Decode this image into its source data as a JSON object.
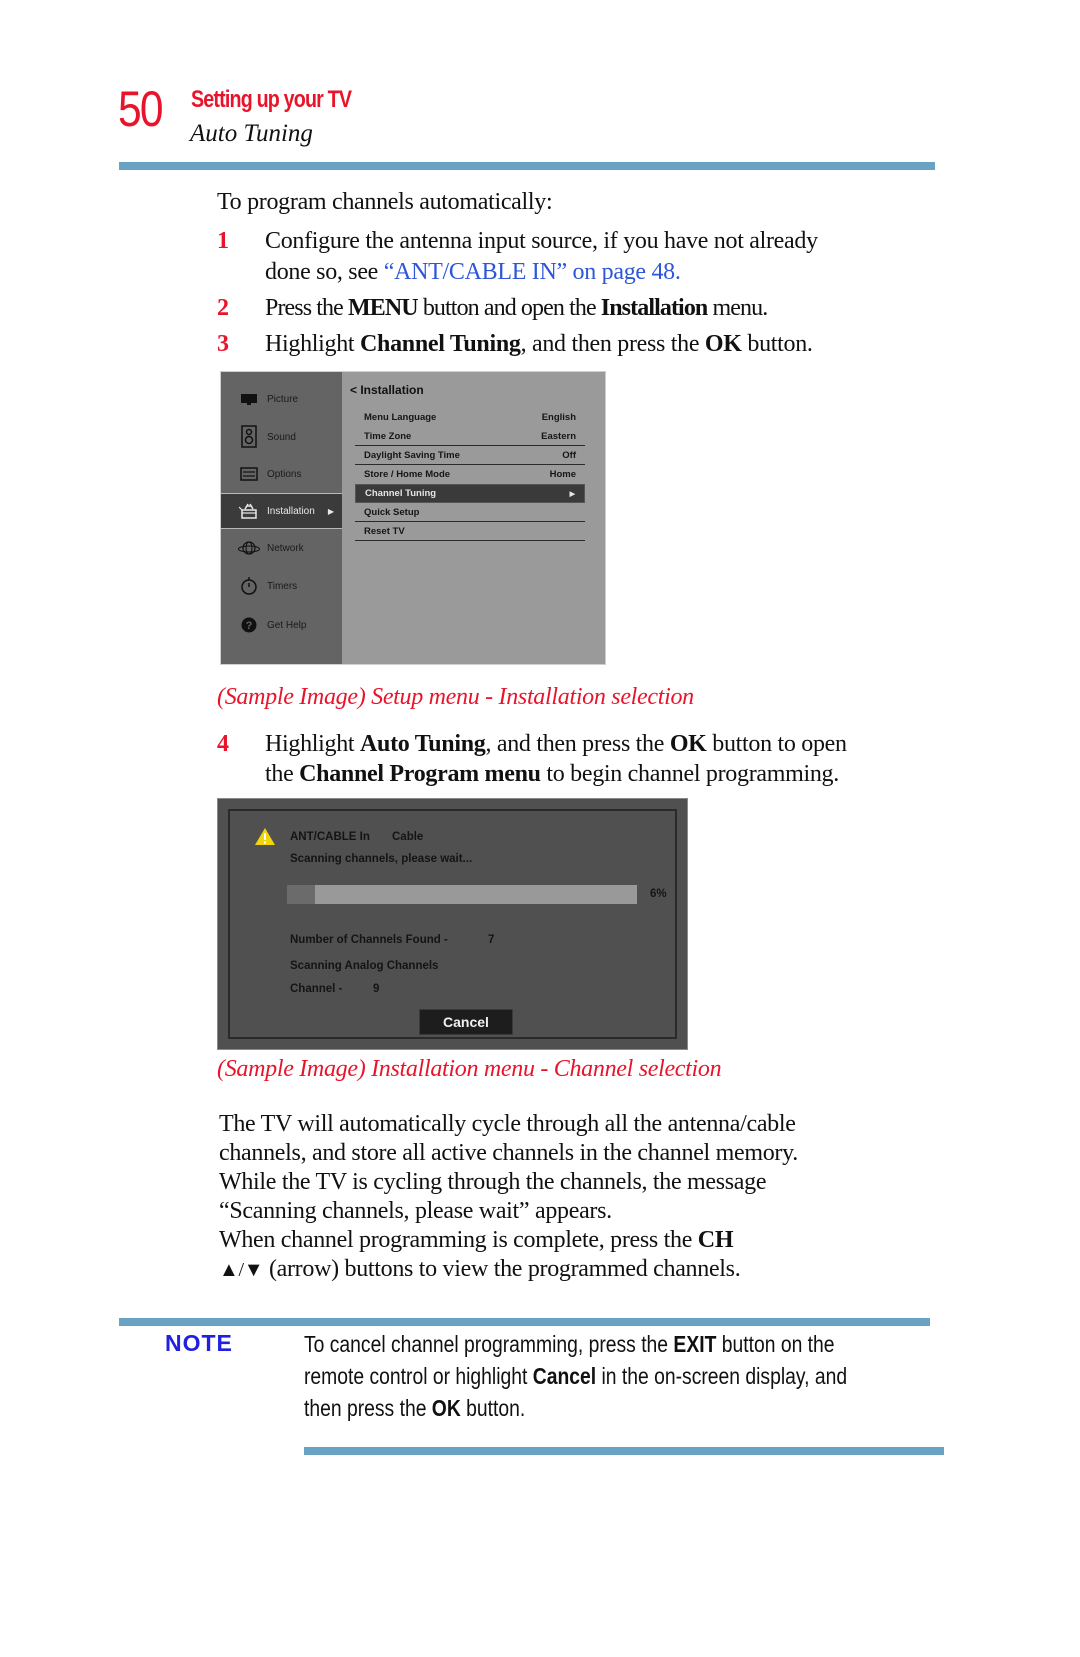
{
  "header": {
    "page_number": "50",
    "chapter": "Setting up your TV",
    "section": "Auto Tuning"
  },
  "intro": "To program channels automatically:",
  "steps": [
    {
      "num": "1",
      "line1": "Configure the antenna input source, if you have not already",
      "line2_pre": "done so, see ",
      "line2_link": "“ANT/CABLE IN” on page 48."
    },
    {
      "num": "2",
      "pre": "Press the ",
      "b1": "MENU",
      "mid": " button and open the ",
      "b2": "Installation",
      "post": " menu."
    },
    {
      "num": "3",
      "pre": "Highlight ",
      "b1": "Channel Tuning",
      "mid": ", and then press the ",
      "b2": "OK",
      "post": " button."
    },
    {
      "num": "4",
      "pre": "Highlight ",
      "b1": "Auto Tuning",
      "mid": ", and then press the ",
      "b2": "OK",
      "post": " button to open",
      "line2_pre": "the ",
      "line2_b": "Channel Program menu",
      "line2_post": " to begin channel programming."
    }
  ],
  "setup_menu": {
    "sidebar": [
      {
        "label": "Picture",
        "icon": "tv-icon"
      },
      {
        "label": "Sound",
        "icon": "speaker-icon"
      },
      {
        "label": "Options",
        "icon": "options-icon"
      },
      {
        "label": "Installation",
        "icon": "toolbox-icon",
        "active": true
      },
      {
        "label": "Network",
        "icon": "globe-icon"
      },
      {
        "label": "Timers",
        "icon": "stopwatch-icon"
      },
      {
        "label": "Get Help",
        "icon": "help-icon"
      }
    ],
    "title": "< Installation",
    "rows": [
      {
        "label": "Menu Language",
        "value": "English"
      },
      {
        "label": "Time Zone",
        "value": "Eastern"
      },
      {
        "label": "Daylight Saving Time",
        "value": "Off"
      },
      {
        "label": "Store / Home Mode",
        "value": "Home"
      },
      {
        "label": "Channel Tuning",
        "value": "▶",
        "selected": true
      },
      {
        "label": "Quick Setup",
        "value": ""
      },
      {
        "label": "Reset TV",
        "value": ""
      }
    ]
  },
  "caption1": "(Sample Image) Setup menu - Installation selection",
  "scan_dialog": {
    "input_label": "ANT/CABLE In",
    "input_value": "Cable",
    "status": "Scanning channels, please wait...",
    "progress_percent": 6,
    "progress_label": "6%",
    "found_label": "Number of Channels Found  -",
    "found_value": "7",
    "scan_type": "Scanning Analog Channels",
    "channel_label": "Channel  -",
    "channel_value": "9",
    "cancel_label": "Cancel"
  },
  "caption2": "(Sample Image)  Installation menu - Channel selection",
  "paragraph": {
    "lines": [
      "The TV will automatically cycle through all the antenna/cable",
      "channels, and store all active channels in the channel memory.",
      "While the TV is cycling through the channels, the message",
      "“Scanning channels, please wait” appears."
    ],
    "last_pre": "When channel programming is complete, press the ",
    "last_b": "CH",
    "arrows": "▲/▼",
    "last_post": " (arrow) buttons to view the programmed channels."
  },
  "note": {
    "label": "NOTE",
    "l1_pre": "To cancel channel programming, press the ",
    "l1_b": "EXIT",
    "l1_post": " button on the",
    "l2_pre": "remote control or highlight ",
    "l2_b": "Cancel",
    "l2_post": " in the on-screen display, and",
    "l3_pre": "then press the ",
    "l3_b": "OK",
    "l3_post": " button."
  },
  "colors": {
    "accent_red": "#e8142b",
    "link_blue": "#2d56d8",
    "rule_blue": "#6aa2c4",
    "note_blue": "#2020e0"
  }
}
